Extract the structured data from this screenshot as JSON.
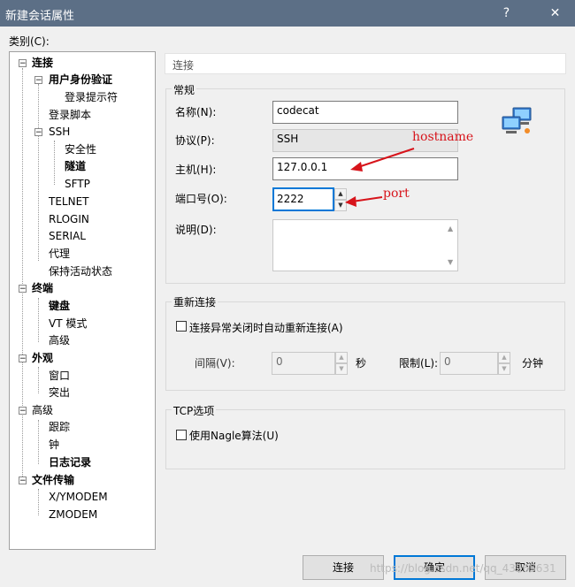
{
  "window": {
    "title": "新建会话属性",
    "help_label": "?",
    "close_label": "✕"
  },
  "category_label": "类别(C):",
  "tree": {
    "items": [
      {
        "label": "连接",
        "bold": true
      },
      {
        "label": "用户身份验证",
        "bold": true
      },
      {
        "label": "登录提示符",
        "bold": false
      },
      {
        "label": "登录脚本",
        "bold": false
      },
      {
        "label": "SSH",
        "bold": false
      },
      {
        "label": "安全性",
        "bold": false
      },
      {
        "label": "隧道",
        "bold": true
      },
      {
        "label": "SFTP",
        "bold": false
      },
      {
        "label": "TELNET",
        "bold": false
      },
      {
        "label": "RLOGIN",
        "bold": false
      },
      {
        "label": "SERIAL",
        "bold": false
      },
      {
        "label": "代理",
        "bold": false
      },
      {
        "label": "保持活动状态",
        "bold": false
      },
      {
        "label": "终端",
        "bold": true
      },
      {
        "label": "键盘",
        "bold": true
      },
      {
        "label": "VT 模式",
        "bold": false
      },
      {
        "label": "高级",
        "bold": false
      },
      {
        "label": "外观",
        "bold": true
      },
      {
        "label": "窗口",
        "bold": false
      },
      {
        "label": "突出",
        "bold": false
      },
      {
        "label": "高级",
        "bold": false
      },
      {
        "label": "跟踪",
        "bold": false
      },
      {
        "label": "钟",
        "bold": false
      },
      {
        "label": "日志记录",
        "bold": true
      },
      {
        "label": "文件传输",
        "bold": true
      },
      {
        "label": "X/YMODEM",
        "bold": false
      },
      {
        "label": "ZMODEM",
        "bold": false
      }
    ],
    "expander_minus": "−"
  },
  "panel": {
    "header": "连接",
    "general": {
      "title": "常规",
      "name_label": "名称(N):",
      "name_value": "codecat",
      "protocol_label": "协议(P):",
      "protocol_value": "SSH",
      "host_label": "主机(H):",
      "host_value": "127.0.0.1",
      "port_label": "端口号(O):",
      "port_value": "2222",
      "desc_label": "说明(D):",
      "desc_value": ""
    },
    "reconnect": {
      "title": "重新连接",
      "auto_reconnect_label": "连接异常关闭时自动重新连接(A)",
      "interval_label": "间隔(V):",
      "interval_value": "0",
      "interval_unit": "秒",
      "limit_label": "限制(L):",
      "limit_value": "0",
      "limit_unit": "分钟"
    },
    "tcp": {
      "title": "TCP选项",
      "nagle_label": "使用Nagle算法(U)"
    }
  },
  "annotations": {
    "hostname": "hostname",
    "port": "port",
    "arrow_color": "#d7141b"
  },
  "buttons": {
    "connect": "连接",
    "ok": "确定",
    "cancel": "取消"
  },
  "watermark": "https://blog.csdn.net/qq_43265631",
  "spin_up": "▲",
  "spin_down": "▼",
  "scroll_up": "▲",
  "scroll_down": "▼"
}
